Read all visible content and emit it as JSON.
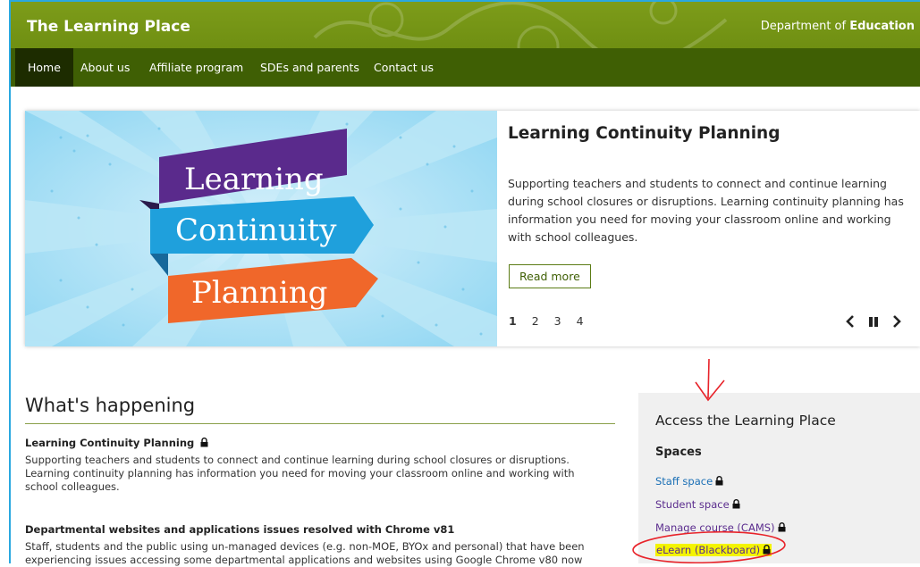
{
  "header": {
    "site_title": "The Learning Place",
    "dept_prefix": "Department of ",
    "dept_bold": "Education"
  },
  "nav": {
    "items": [
      {
        "label": "Home",
        "active": true
      },
      {
        "label": "About us"
      },
      {
        "label": "Affiliate program"
      },
      {
        "label": "SDEs and parents"
      },
      {
        "label": "Contact us"
      }
    ]
  },
  "hero": {
    "image_words": [
      "Learning",
      "Continuity",
      "Planning"
    ],
    "title": "Learning Continuity Planning",
    "body": "Supporting teachers and students to connect and continue learning during school closures or disruptions. Learning continuity planning has information you need for moving your classroom online and working with school colleagues.",
    "read_more": "Read more",
    "pages": [
      "1",
      "2",
      "3",
      "4"
    ],
    "current_page": "1"
  },
  "whats_happening": {
    "title": "What's happening",
    "items": [
      {
        "title": "Learning Continuity Planning",
        "locked": true,
        "body": "Supporting teachers and students to connect and continue learning during school closures or disruptions. Learning continuity planning has information you need for moving your classroom online and working with school colleagues."
      },
      {
        "title": "Departmental websites and applications issues resolved with Chrome v81",
        "locked": false,
        "body": "Staff, students and the public using un-managed devices (e.g. non-MOE, BYOx and personal) that have been experiencing issues accessing some departmental applications and websites using Google Chrome v80 now"
      }
    ]
  },
  "access": {
    "title": "Access the Learning Place",
    "spaces_title": "Spaces",
    "links": [
      {
        "label": "Staff space",
        "color": "#1a6fb5"
      },
      {
        "label": "Student space",
        "color": "#5b2d8e"
      },
      {
        "label": "Manage course (CAMS)",
        "color": "#5b2d8e"
      },
      {
        "label": "eLearn (Blackboard)",
        "color": "#5b2d8e",
        "highlighted": true
      }
    ]
  },
  "colors": {
    "header_green": "#7d9c1a",
    "nav_green": "#3f5f04",
    "nav_active": "#1d2c00",
    "annotation_red": "#e8232a",
    "highlight_yellow": "#f4f400"
  }
}
